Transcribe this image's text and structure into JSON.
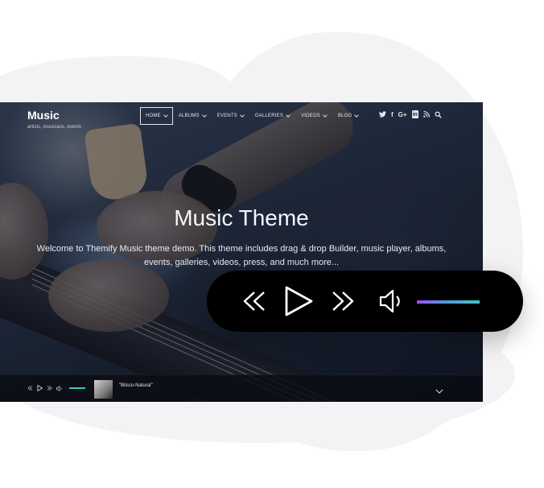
{
  "site": {
    "logo": "Music",
    "tagline": "artists, musicians, events"
  },
  "nav": {
    "items": [
      {
        "label": "HOME",
        "active": true
      },
      {
        "label": "ALBUMS",
        "active": false
      },
      {
        "label": "EVENTS",
        "active": false
      },
      {
        "label": "GALLERIES",
        "active": false
      },
      {
        "label": "VIDEOS",
        "active": false
      },
      {
        "label": "BLOG",
        "active": false
      }
    ]
  },
  "social": {
    "icons": [
      "twitter-icon",
      "facebook-icon",
      "google-plus-icon",
      "linkedin-icon",
      "rss-icon",
      "search-icon"
    ],
    "glyphs": [
      "🐦",
      "f",
      "G+",
      "in",
      ")",
      "⌕"
    ]
  },
  "hero": {
    "title": "Music Theme",
    "description": "Welcome to Themify Music theme demo. This theme includes drag & drop Builder, music player, albums, events, galleries, videos, press, and much more..."
  },
  "mini_player": {
    "track_title": "\"Blisco-Natural\""
  },
  "big_player": {
    "volume_level": 1.0,
    "colors": {
      "background": "#000000",
      "accent_start": "#a14cff",
      "accent_end": "#3ec7c0"
    }
  }
}
